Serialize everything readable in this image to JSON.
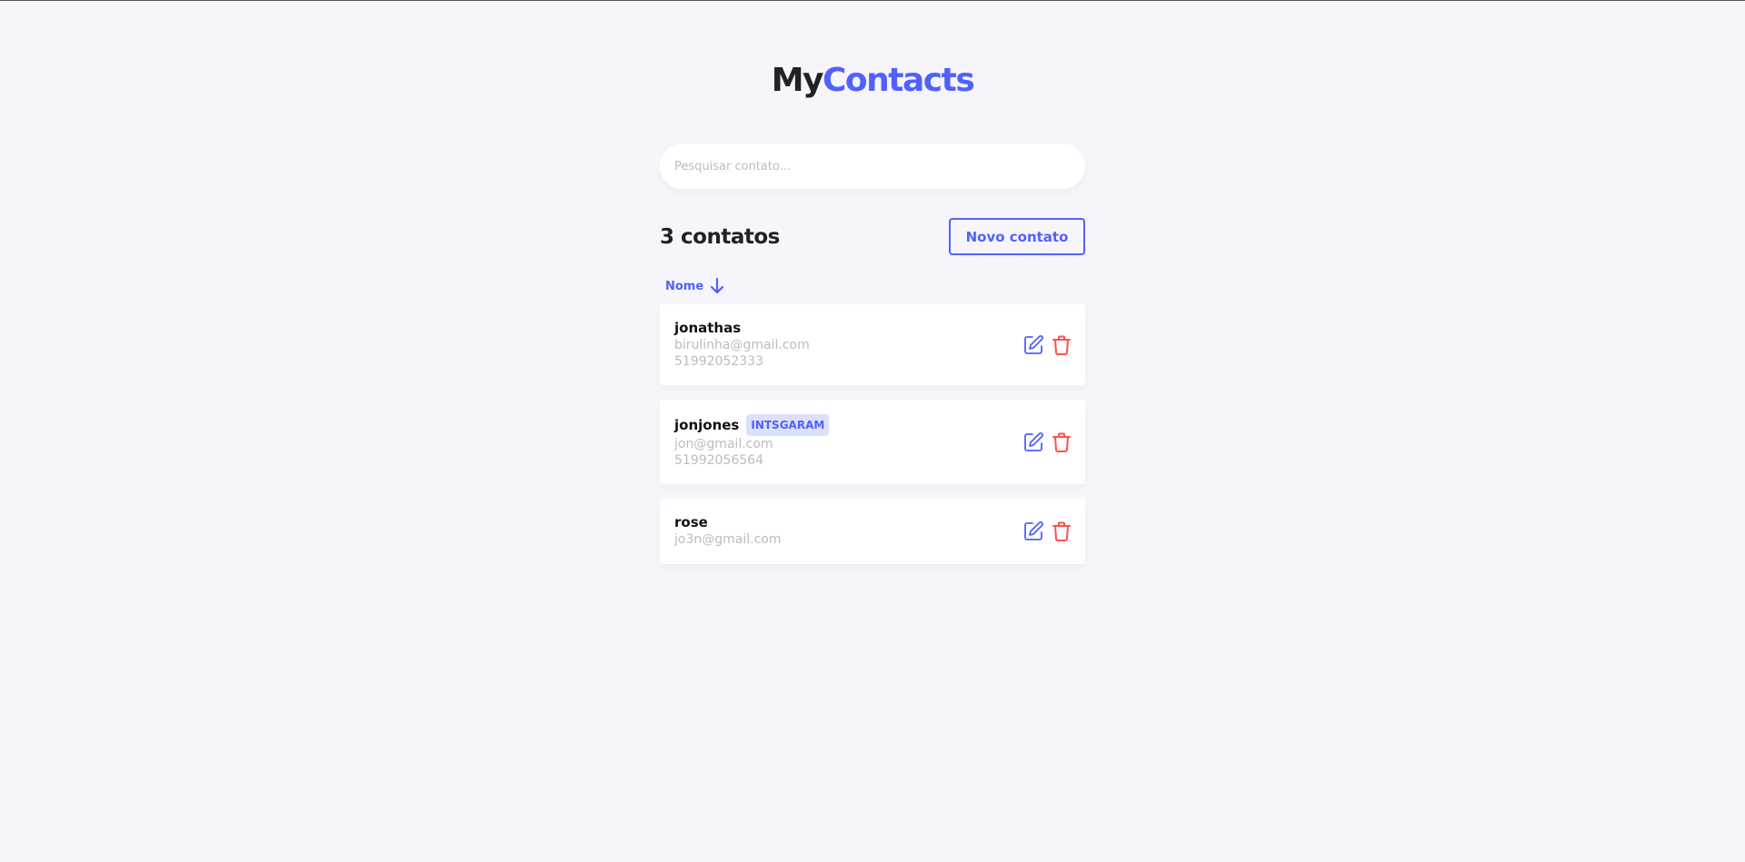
{
  "logo": {
    "part1": "My",
    "part2": "Contacts"
  },
  "search": {
    "placeholder": "Pesquisar contato..."
  },
  "header": {
    "count_label": "3 contatos",
    "new_button": "Novo contato"
  },
  "sort": {
    "label": "Nome",
    "icon": "arrow-down-icon",
    "color": "#5061FC"
  },
  "contacts": [
    {
      "name": "jonathas",
      "email": "birulinha@gmail.com",
      "phone": "51992052333",
      "tag": ""
    },
    {
      "name": "jonjones",
      "email": "jon@gmail.com",
      "phone": "51992056564",
      "tag": "INTSGARAM"
    },
    {
      "name": "rose",
      "email": "jo3n@gmail.com",
      "phone": "",
      "tag": ""
    }
  ],
  "icons": {
    "edit": "edit-icon",
    "delete": "trash-icon"
  },
  "colors": {
    "primary": "#5061FC",
    "danger": "#FC5050",
    "background": "#F6F5FC"
  }
}
